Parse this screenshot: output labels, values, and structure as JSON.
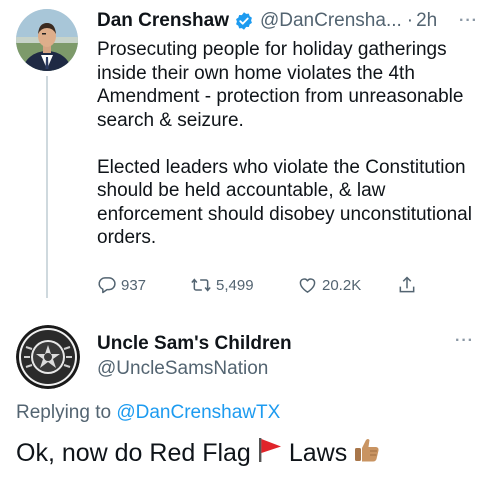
{
  "tweet": {
    "author_name": "Dan Crenshaw",
    "author_handle": "@DanCrensha...",
    "separator": "·",
    "time": "2h",
    "more": "···",
    "paragraphs": [
      "Prosecuting people for holiday gatherings inside their own home violates the 4th Amendment - protection from unreasonable search & seizure.",
      "Elected leaders who violate the Constitution should be held accountable, & law enforcement should disobey unconstitutional orders."
    ],
    "replies": "937",
    "retweets": "5,499",
    "likes": "20.2K",
    "icons": [
      "verified-badge-icon",
      "reply-icon",
      "retweet-icon",
      "like-icon",
      "share-icon"
    ]
  },
  "reply": {
    "author_name": "Uncle Sam's Children",
    "author_handle": "@UncleSamsNation",
    "more": "···",
    "replying_prefix": "Replying to",
    "replying_to": "@DanCrenshawTX",
    "text_before": "Ok, now do Red Flag",
    "text_after": "Laws",
    "emojis": [
      "red-flag-icon",
      "thumbs-up-icon"
    ]
  },
  "colors": {
    "text": "#0f1419",
    "secondary": "#536471",
    "link": "#1d9bf0",
    "verified": "#1d9bf0",
    "flag_red": "#e0242a",
    "thumb": "#c99462"
  }
}
